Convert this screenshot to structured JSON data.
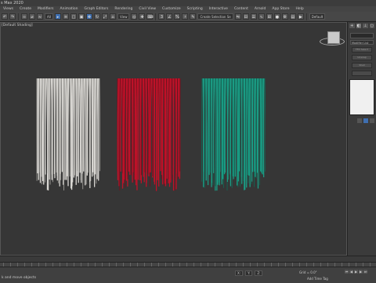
{
  "window": {
    "title": "s Max 2020"
  },
  "menu": [
    "Views",
    "Create",
    "Modifiers",
    "Animation",
    "Graph Editors",
    "Rendering",
    "Civil View",
    "Customize",
    "Scripting",
    "Interactive",
    "Content",
    "Arnold",
    "App Store",
    "Help"
  ],
  "toolbar": {
    "selection_filter": "All",
    "view_dropdown": "View",
    "named_set": "Create Selection Se",
    "workspace": "Default",
    "brand": "s Max 2020"
  },
  "viewport": {
    "label": "[Default Shading]",
    "curtains": [
      {
        "name": "white-curtain",
        "color": "#d8d6d2",
        "strand": "#a9a7a2"
      },
      {
        "name": "red-curtain",
        "color": "#c01128",
        "strand": "#7d0818"
      },
      {
        "name": "teal-curtain",
        "color": "#1a9c84",
        "strand": "#0d6b58"
      }
    ]
  },
  "command_panel": {
    "modifier_list": "Modifier List",
    "buttons": [
      "FFD Select",
      "Unwrap",
      "Shell"
    ]
  },
  "status": {
    "prompt": "k and move objects",
    "grid": "Grid = 0.0\"",
    "add_time_tag": "Add Time Tag"
  }
}
